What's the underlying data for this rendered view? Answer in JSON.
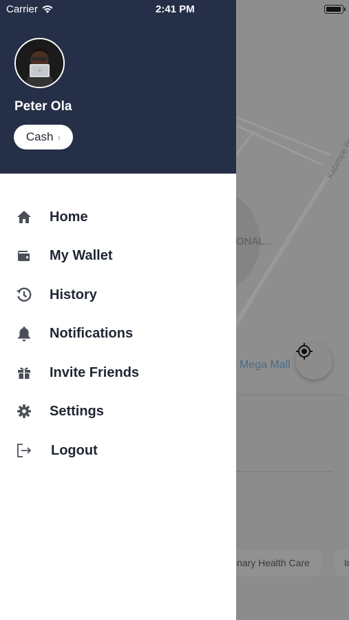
{
  "status_bar": {
    "carrier": "Carrier",
    "time": "2:41 PM"
  },
  "drawer": {
    "user_name": "Peter Ola",
    "payment_method": "Cash",
    "menu": [
      {
        "label": "Home",
        "icon": "home-icon"
      },
      {
        "label": "My Wallet",
        "icon": "wallet-icon"
      },
      {
        "label": "History",
        "icon": "history-icon"
      },
      {
        "label": "Notifications",
        "icon": "bell-icon"
      },
      {
        "label": "Invite Friends",
        "icon": "gift-icon"
      },
      {
        "label": "Settings",
        "icon": "gear-icon"
      },
      {
        "label": "Logout",
        "icon": "logout-icon"
      }
    ]
  },
  "map": {
    "road_label": "Katampe Re",
    "area_label": "ONAL...",
    "place_label": "Mega Mall"
  },
  "bottom_sheet": {
    "chips": [
      "nary Health Care",
      "Ir"
    ]
  },
  "colors": {
    "header_bg": "#252f47",
    "menu_text": "#1f2633",
    "icon_gray": "#4a4f58"
  }
}
